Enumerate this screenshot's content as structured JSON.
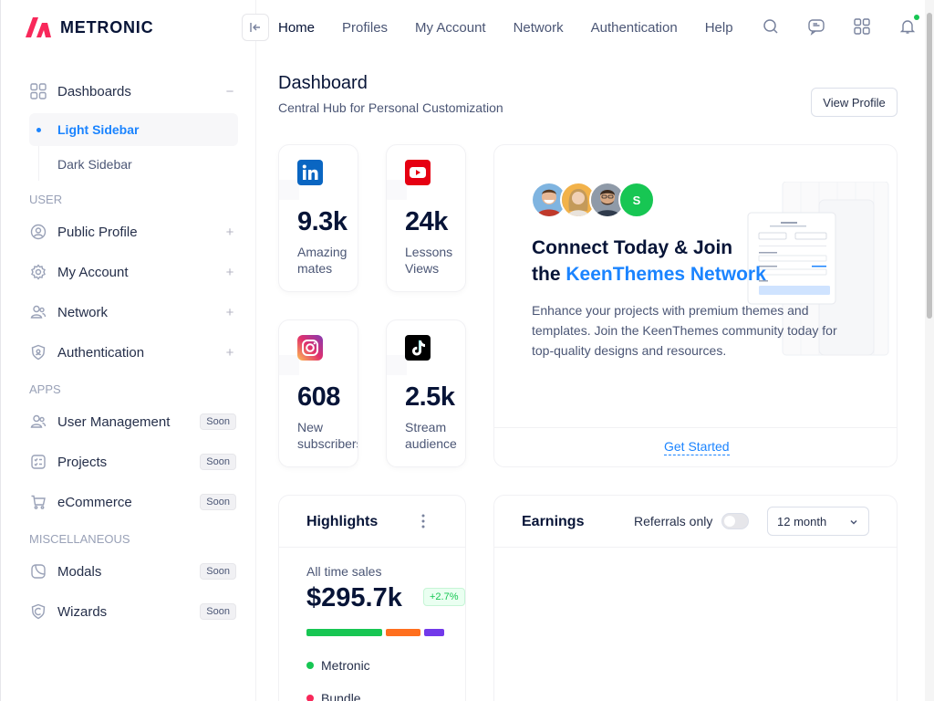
{
  "app": {
    "logo_text": "METRONIC",
    "brand_color": "#F8285A",
    "accent_color": "#1B84FF"
  },
  "topnav": {
    "items": [
      "Home",
      "Profiles",
      "My Account",
      "Network",
      "Authentication",
      "Help"
    ],
    "active": "Home",
    "icons": [
      "search-icon",
      "chat-icon",
      "apps-icon",
      "bell-icon"
    ]
  },
  "sidebar": {
    "dashboards": {
      "label": "Dashboards",
      "toggle": "−",
      "children": [
        {
          "label": "Light Sidebar",
          "active": true
        },
        {
          "label": "Dark Sidebar",
          "active": false
        }
      ]
    },
    "user_heading": "USER",
    "user_items": [
      {
        "label": "Public Profile",
        "icon": "profile-circle-icon",
        "tail": "+"
      },
      {
        "label": "My Account",
        "icon": "gear-icon",
        "tail": "+"
      },
      {
        "label": "Network",
        "icon": "users-icon",
        "tail": "+"
      },
      {
        "label": "Authentication",
        "icon": "shield-icon",
        "tail": "+"
      }
    ],
    "apps_heading": "APPS",
    "apps_items": [
      {
        "label": "User Management",
        "icon": "users-icon",
        "badge": "Soon"
      },
      {
        "label": "Projects",
        "icon": "checklist-icon",
        "badge": "Soon"
      },
      {
        "label": "eCommerce",
        "icon": "cart-icon",
        "badge": "Soon"
      }
    ],
    "misc_heading": "MISCELLANEOUS",
    "misc_items": [
      {
        "label": "Modals",
        "icon": "modal-icon",
        "badge": "Soon"
      },
      {
        "label": "Wizards",
        "icon": "wizard-icon",
        "badge": "Soon"
      }
    ]
  },
  "page": {
    "title": "Dashboard",
    "subtitle": "Central Hub for Personal Customization",
    "view_profile_label": "View Profile"
  },
  "stats": [
    {
      "value": "9.3k",
      "label": "Amazing mates",
      "icon": "linkedin-icon"
    },
    {
      "value": "24k",
      "label": "Lessons Views",
      "icon": "youtube-icon"
    },
    {
      "value": "608",
      "label": "New subscribers",
      "icon": "instagram-icon"
    },
    {
      "value": "2.5k",
      "label": "Stream audience",
      "icon": "tiktok-icon"
    }
  ],
  "connect": {
    "avatar_letter": "S",
    "title_line1": "Connect Today & Join",
    "title_line2_prefix": "the ",
    "title_line2_highlight": "KeenThemes Network",
    "text": "Enhance your projects with premium themes and templates. Join the KeenThemes community today for top-quality designs and resources.",
    "cta": "Get Started"
  },
  "highlights": {
    "title": "Highlights",
    "menu_icon": "dots-vertical-icon",
    "all_time_label": "All time sales",
    "all_time_value": "$295.7k",
    "change_badge": "+2.7%",
    "segments": [
      {
        "color": "#17C653",
        "share": 0.5
      },
      {
        "color": "#FF6F1E",
        "share": 0.23
      },
      {
        "color": "#7239EA",
        "share": 0.13
      }
    ],
    "legend": [
      {
        "label": "Metronic",
        "color": "#17C653"
      },
      {
        "label": "Bundle",
        "color": "#F8285A"
      }
    ]
  },
  "earnings": {
    "title": "Earnings",
    "referrals_label": "Referrals only",
    "referrals_on": false,
    "period_value": "12 month"
  }
}
